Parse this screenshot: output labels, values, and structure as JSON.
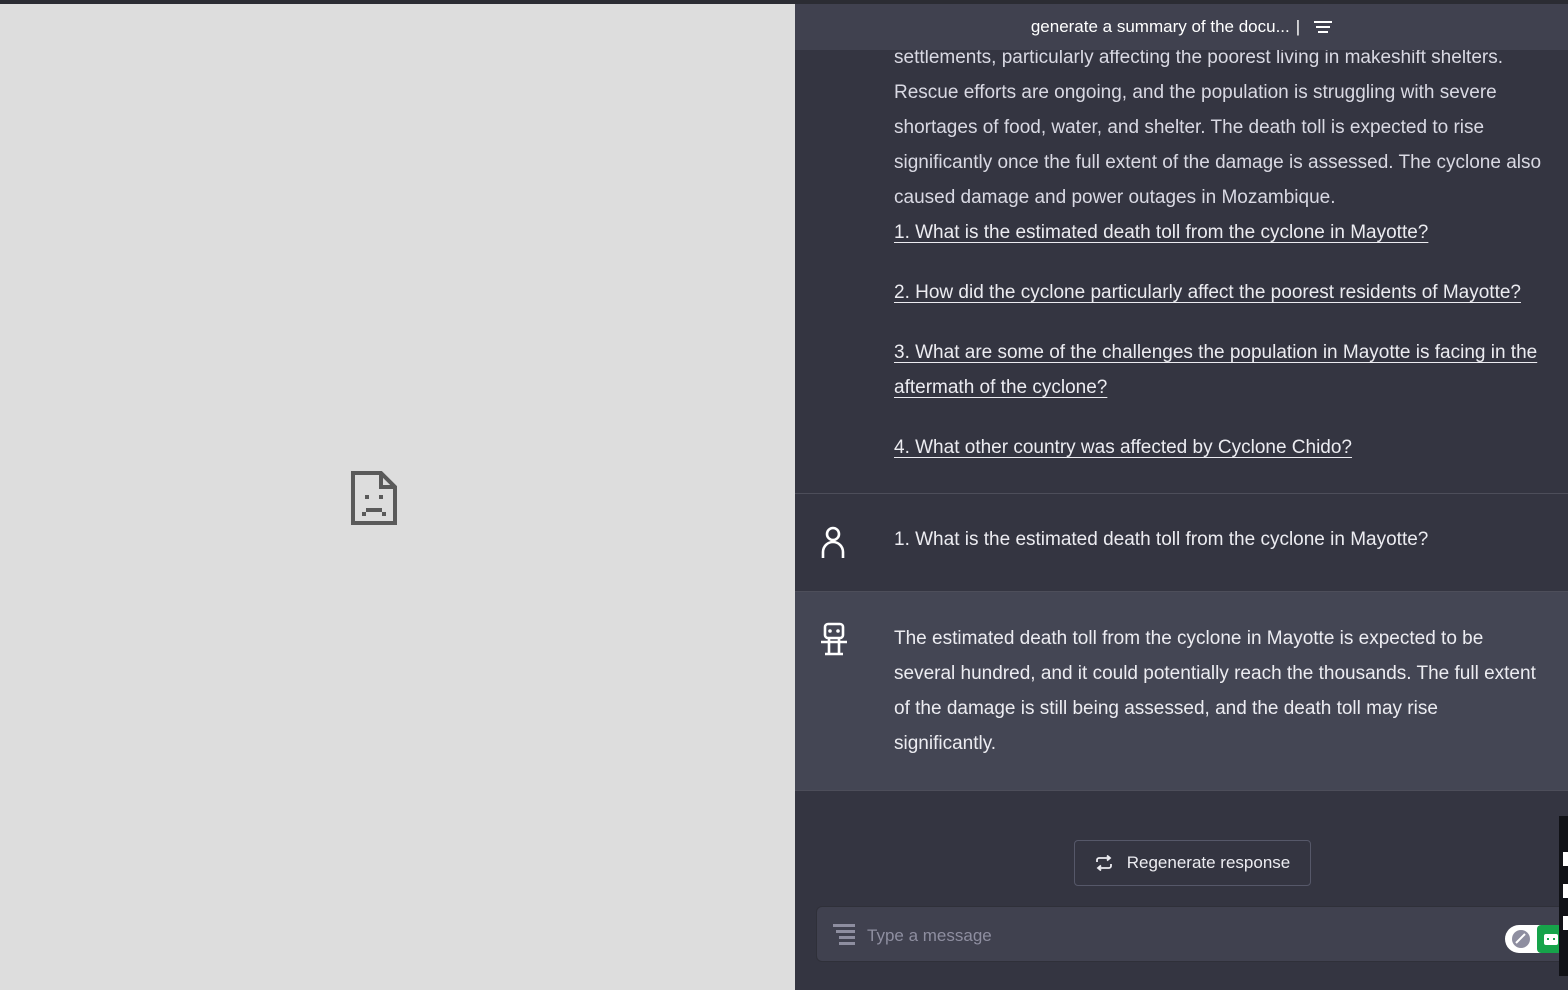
{
  "header": {
    "title": "generate a summary of the docu...",
    "cursor": "|"
  },
  "previous_answer": {
    "paragraph": "settlements, particularly affecting the poorest living in makeshift shelters. Rescue efforts are ongoing, and the population is struggling with severe shortages of food, water, and shelter. The death toll is expected to rise significantly once the full extent of the damage is assessed. The cyclone also caused damage and power outages in Mozambique.",
    "suggested_questions": [
      "1. What is the estimated death toll from the cyclone in Mayotte? ",
      "2. How did the cyclone particularly affect the poorest residents of Mayotte? ",
      "3. What are some of the challenges the population in Mayotte is facing in the aftermath of the cyclone? ",
      "4. What other country was affected by Cyclone Chido? "
    ]
  },
  "user_message": "1. What is the estimated death toll from the cyclone in Mayotte?",
  "bot_message": "The estimated death toll from the cyclone in Mayotte is expected to be several hundred, and it could potentially reach the thousands. The full extent of the damage is still being assessed, and the death toll may rise significantly.",
  "regenerate_label": "Regenerate response",
  "composer": {
    "placeholder": "Type a message"
  },
  "icons": {
    "broken_page": "broken-document-icon",
    "menu": "menu-icon",
    "user": "user-avatar-icon",
    "bot": "robot-avatar-icon",
    "regenerate": "refresh-icon",
    "composer": "prompt-lines-icon"
  },
  "colors": {
    "chat_bg": "#343541",
    "bot_row_bg": "#444654",
    "header_bg": "#40414f",
    "left_pane_bg": "#dddddd",
    "extension_green": "#16a34a"
  }
}
